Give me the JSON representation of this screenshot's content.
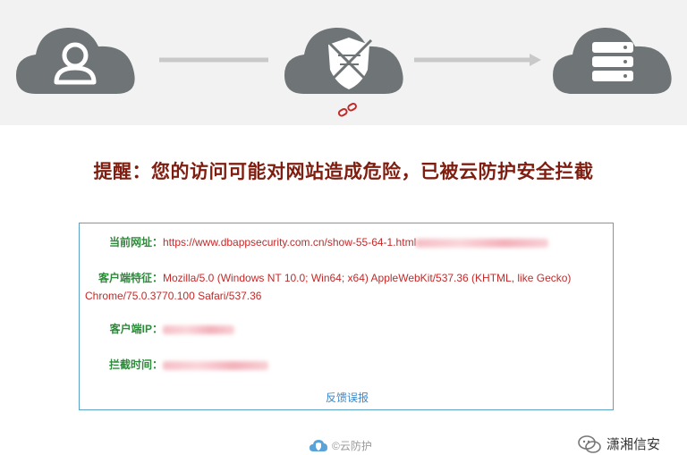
{
  "title": "提醒：您的访问可能对网站造成危险，已被云防护安全拦截",
  "info": {
    "url_label": "当前网址：",
    "url_value": "https://www.dbappsecurity.com.cn/show-55-64-1.html",
    "ua_label": "客户端特征：",
    "ua_line1": "Mozilla/5.0 (Windows NT 10.0; Win64; x64) AppleWebKit/537.36 (KHTML, like Gecko)",
    "ua_line2": "Chrome/75.0.3770.100 Safari/537.36",
    "ip_label": "客户端IP：",
    "time_label": "拦截时间：",
    "feedback": "反馈误报"
  },
  "footer": {
    "text": "©云防护",
    "icon": "cloud-shield-icon"
  },
  "watermark": {
    "text": "潇湘信安",
    "icon": "wechat-icon"
  },
  "colors": {
    "title": "#7f1d10",
    "label": "#2d8a3a",
    "value": "#c62828",
    "link": "#3a86c8",
    "cloud": "#6f7577"
  }
}
